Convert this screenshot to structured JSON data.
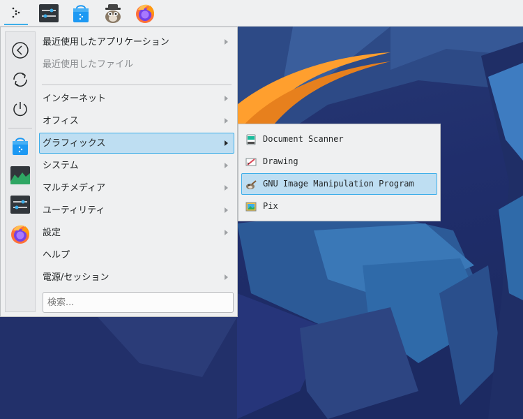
{
  "menu": {
    "items": [
      {
        "label": "最近使用したアプリケーション",
        "arrow": true,
        "state": "normal"
      },
      {
        "label": "最近使用したファイル",
        "arrow": false,
        "state": "disabled"
      },
      {
        "label": "インターネット",
        "arrow": true,
        "state": "normal"
      },
      {
        "label": "オフィス",
        "arrow": true,
        "state": "normal"
      },
      {
        "label": "グラフィックス",
        "arrow": true,
        "state": "selected"
      },
      {
        "label": "システム",
        "arrow": true,
        "state": "normal"
      },
      {
        "label": "マルチメディア",
        "arrow": true,
        "state": "normal"
      },
      {
        "label": "ユーティリティ",
        "arrow": true,
        "state": "normal"
      },
      {
        "label": "設定",
        "arrow": true,
        "state": "normal"
      },
      {
        "label": "ヘルプ",
        "arrow": false,
        "state": "normal"
      },
      {
        "label": "電源/セッション",
        "arrow": true,
        "state": "normal"
      }
    ],
    "search_placeholder": "検索..."
  },
  "submenu": {
    "items": [
      {
        "label": "Document Scanner",
        "icon": "scanner-icon",
        "state": "normal"
      },
      {
        "label": "Drawing",
        "icon": "drawing-icon",
        "state": "normal"
      },
      {
        "label": "GNU Image Manipulation Program",
        "icon": "gimp-icon",
        "state": "selected"
      },
      {
        "label": "Pix",
        "icon": "pix-icon",
        "state": "normal"
      }
    ]
  },
  "panel": {
    "launchers": [
      "application-launcher-icon",
      "system-settings-icon",
      "discover-store-icon",
      "gimp-wilber-icon",
      "firefox-icon"
    ]
  },
  "favorites": [
    "back-icon",
    "refresh-icon",
    "power-icon",
    "discover-store-icon",
    "system-monitor-icon",
    "system-settings-icon",
    "firefox-icon"
  ],
  "colors": {
    "accent": "#3daee9",
    "selection": "#bedef2",
    "panel_bg": "#eff0f1"
  }
}
